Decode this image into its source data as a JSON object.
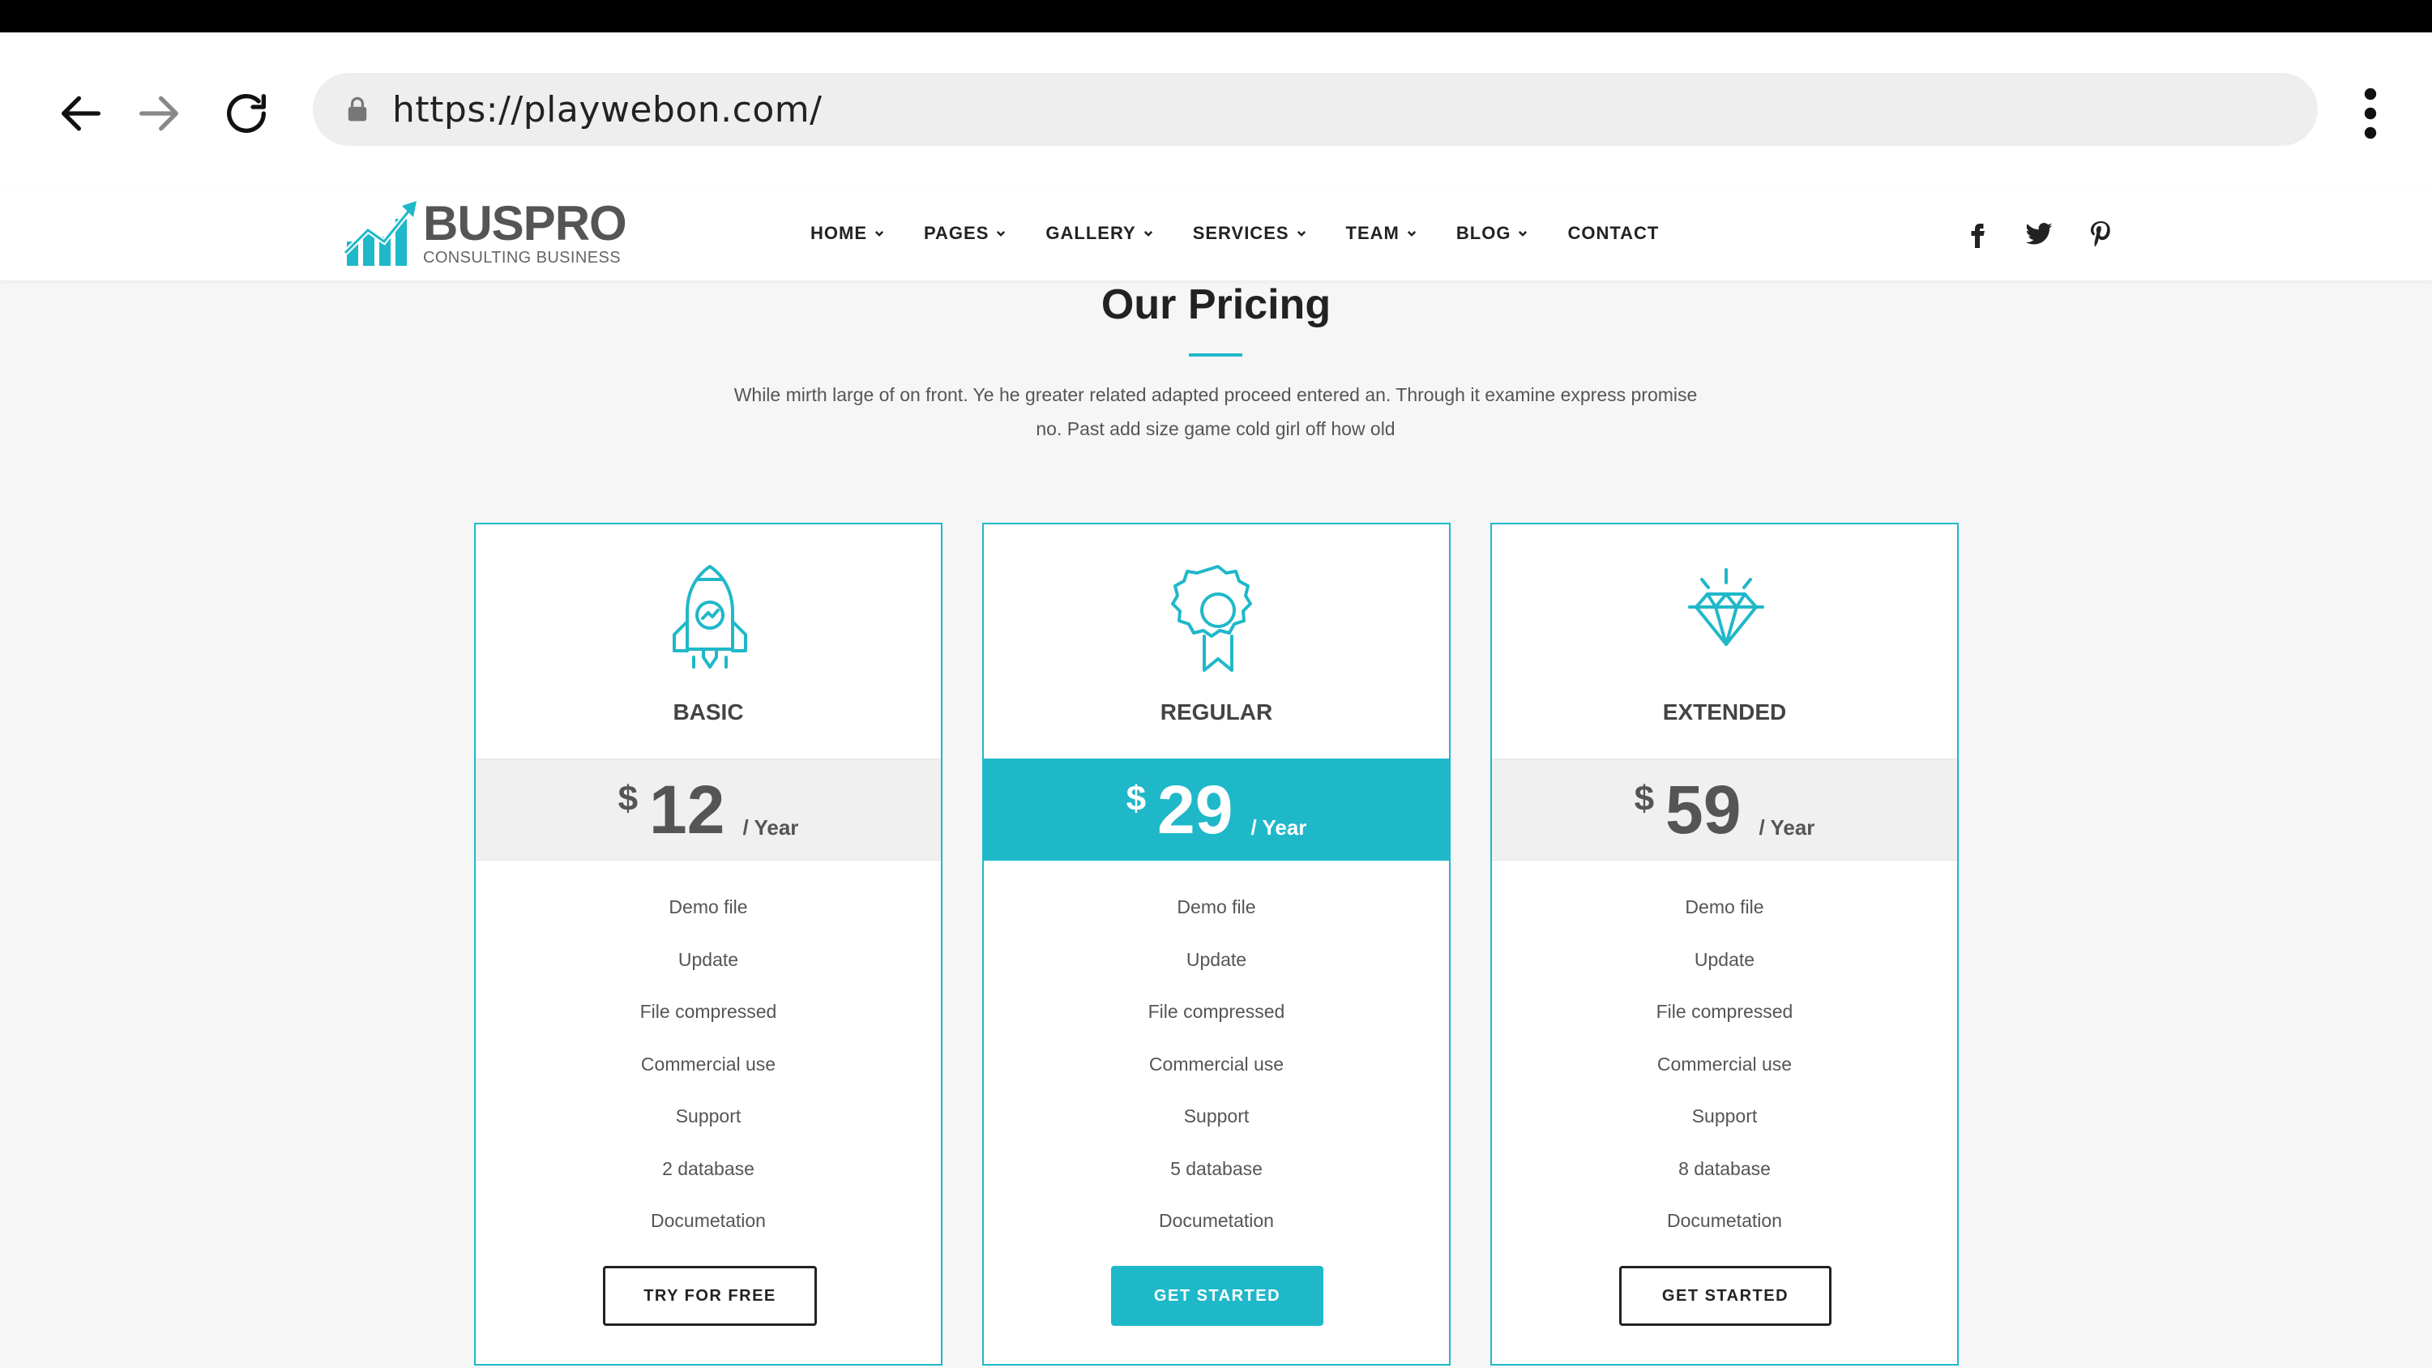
{
  "browser": {
    "url": "https://playwebon.com/",
    "icons": {
      "back": "arrow-left-icon",
      "forward": "arrow-right-icon",
      "reload": "reload-icon",
      "lock": "lock-icon",
      "menu": "more-vertical-icon"
    }
  },
  "header": {
    "logo": {
      "name": "BUSPRO",
      "tagline": "CONSULTING BUSINESS"
    },
    "nav": [
      {
        "label": "HOME",
        "has_dropdown": true
      },
      {
        "label": "PAGES",
        "has_dropdown": true
      },
      {
        "label": "GALLERY",
        "has_dropdown": true
      },
      {
        "label": "SERVICES",
        "has_dropdown": true
      },
      {
        "label": "TEAM",
        "has_dropdown": true
      },
      {
        "label": "BLOG",
        "has_dropdown": true
      },
      {
        "label": "CONTACT",
        "has_dropdown": false
      }
    ],
    "social": [
      "facebook-icon",
      "twitter-icon",
      "pinterest-icon"
    ]
  },
  "pricing": {
    "title": "Our Pricing",
    "description": "While mirth large of on front. Ye he greater related adapted proceed entered an. Through it examine express promise no. Past add size game cold girl off how old",
    "plans": [
      {
        "name": "BASIC",
        "icon": "rocket-icon",
        "currency": "$",
        "amount": "12",
        "period": "/ Year",
        "featured": false,
        "features": [
          "Demo file",
          "Update",
          "File compressed",
          "Commercial use",
          "Support",
          "2 database",
          "Documetation"
        ],
        "cta": "TRY FOR FREE"
      },
      {
        "name": "REGULAR",
        "icon": "award-icon",
        "currency": "$",
        "amount": "29",
        "period": "/ Year",
        "featured": true,
        "features": [
          "Demo file",
          "Update",
          "File compressed",
          "Commercial use",
          "Support",
          "5 database",
          "Documetation"
        ],
        "cta": "GET STARTED"
      },
      {
        "name": "EXTENDED",
        "icon": "diamond-icon",
        "currency": "$",
        "amount": "59",
        "period": "/ Year",
        "featured": false,
        "features": [
          "Demo file",
          "Update",
          "File compressed",
          "Commercial use",
          "Support",
          "8 database",
          "Documetation"
        ],
        "cta": "GET STARTED"
      }
    ]
  },
  "colors": {
    "accent": "#1fb8c9",
    "text_dark": "#222222",
    "text_muted": "#555555",
    "page_bg": "#f6f6f6"
  }
}
